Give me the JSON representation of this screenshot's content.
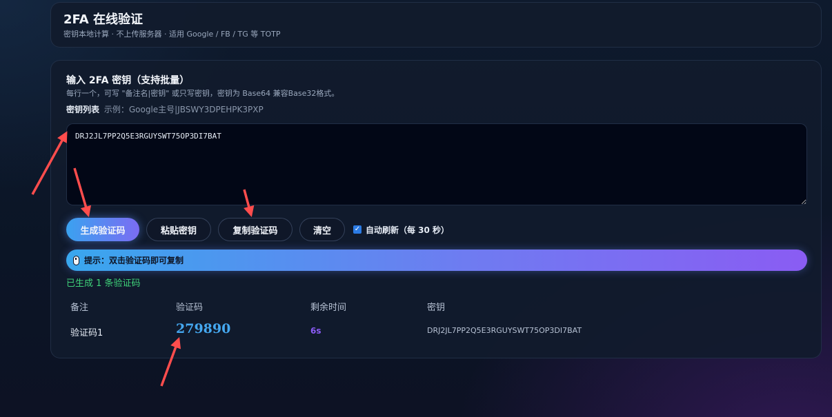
{
  "header": {
    "title": "2FA 在线验证",
    "subtitle": "密钥本地计算 · 不上传服务器 · 适用 Google / FB / TG 等 TOTP"
  },
  "input_section": {
    "title": "输入 2FA 密钥（支持批量）",
    "description": "每行一个，可写 \"备注名|密钥\" 或只写密钥，密钥为 Base64 兼容Base32格式。",
    "keys_label": "密钥列表",
    "keys_example": "示例：Google主号|JBSWY3DPEHPK3PXP",
    "keys_value": "DRJ2JL7PP2Q5E3RGUYSWT75OP3DI7BAT"
  },
  "buttons": {
    "generate": "生成验证码",
    "paste": "粘贴密钥",
    "copy": "复制验证码",
    "clear": "清空"
  },
  "auto_refresh": {
    "label": "自动刷新（每 30 秒）",
    "checked": true
  },
  "tip": {
    "icon": "mouse-icon",
    "text": "提示：双击验证码即可复制"
  },
  "status": "已生成 1 条验证码",
  "table": {
    "headers": [
      "备注",
      "验证码",
      "剩余时间",
      "密钥"
    ],
    "rows": [
      {
        "name": "验证码1",
        "code": "279890",
        "remaining": "6s",
        "secret": "DRJ2JL7PP2Q5E3RGUYSWT75OP3DI7BAT"
      }
    ]
  },
  "colors": {
    "accent_start": "#3aa2f0",
    "accent_end": "#8a5cf3",
    "success": "#3fd37a",
    "code": "#45a8f0",
    "remaining": "#8b5cf6",
    "annotation_arrow": "#ff4d4d"
  }
}
